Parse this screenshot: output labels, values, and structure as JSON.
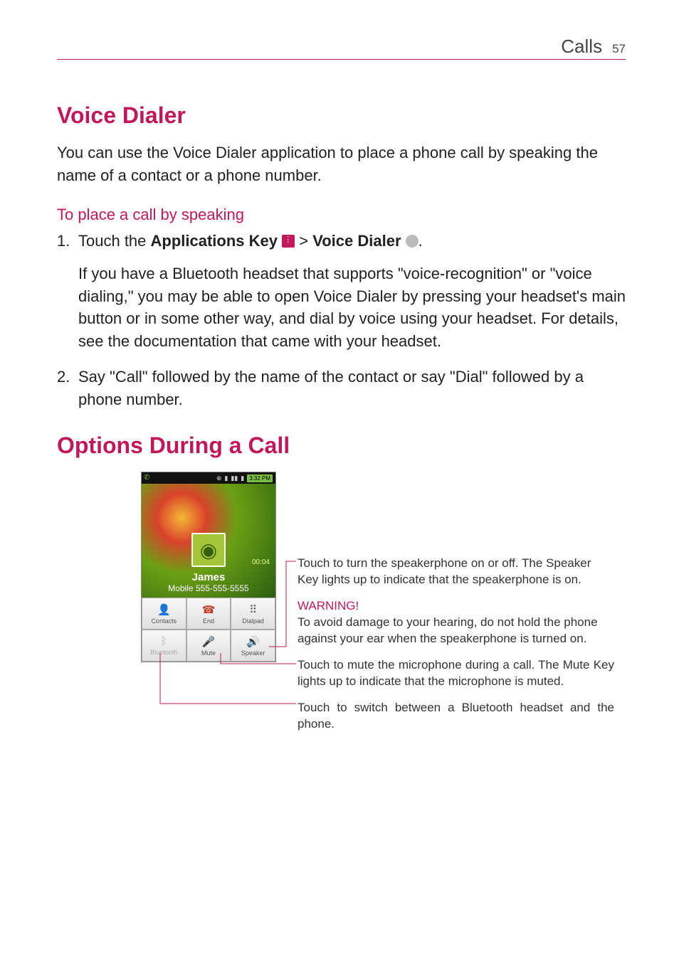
{
  "header": {
    "section": "Calls",
    "page_num": "57"
  },
  "section1": {
    "title": "Voice Dialer",
    "intro": "You can use the Voice Dialer application to place a phone call by speaking the name of a contact or a phone number.",
    "subhead": "To place a call by speaking",
    "step1_prefix": "1.",
    "step1_a": "Touch the ",
    "step1_b": "Applications Key",
    "step1_c": " > ",
    "step1_d": "Voice Dialer",
    "step1_e": ".",
    "step1_body": "If you have a Bluetooth headset that supports \"voice-recognition\" or \"voice dialing,\" you may be able to open Voice Dialer by pressing your headset's main button or in some other way, and dial by voice using your headset. For details, see the documentation that came with your headset.",
    "step2_prefix": "2.",
    "step2_body": "Say \"Call\" followed by the name of the contact or say \"Dial\" followed by a phone number."
  },
  "section2": {
    "title": "Options During a Call",
    "statusbar_time": "3:32 PM",
    "call_timer": "00:04",
    "contact_name": "James",
    "contact_number": "Mobile 555-555-5555",
    "buttons": {
      "contacts": "Contacts",
      "end": "End",
      "dialpad": "Dialpad",
      "bluetooth": "Bluetooth",
      "mute": "Mute",
      "speaker": "Speaker"
    },
    "anno_speaker": "Touch to turn the speakerphone on or off. The Speaker Key lights up to indicate that the speakerphone is on.",
    "warning_label": "WARNING!",
    "warning_body": "To avoid damage to your hearing, do not hold the phone against your ear when the speakerphone is turned on.",
    "anno_mute": "Touch to mute the microphone during a call. The Mute Key lights up to indicate that the microphone is muted.",
    "anno_bt": "Touch to switch between a Bluetooth headset and the phone."
  }
}
